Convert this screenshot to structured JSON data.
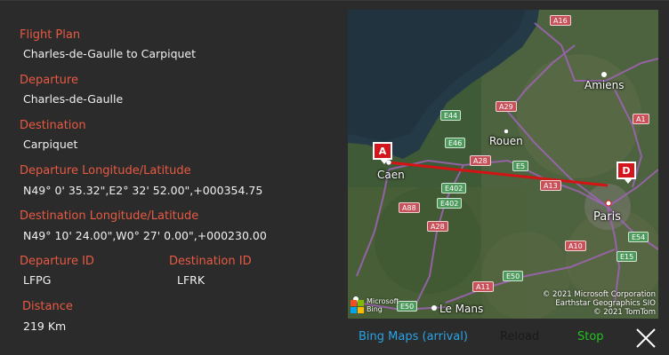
{
  "flight_plan": {
    "label": "Flight Plan",
    "value": "Charles-de-Gaulle to Carpiquet"
  },
  "departure": {
    "label": "Departure",
    "value": "Charles-de-Gaulle"
  },
  "destination": {
    "label": "Destination",
    "value": "Carpiquet"
  },
  "departure_coords": {
    "label": "Departure Longitude/Latitude",
    "value": "N49° 0' 35.32\",E2° 32' 52.00\",+000354.75"
  },
  "destination_coords": {
    "label": "Destination Longitude/Latitude",
    "value": "N49° 10' 24.00\",W0° 27' 0.00\",+000230.00"
  },
  "departure_id": {
    "label": "Departure ID",
    "value": "LFPG"
  },
  "destination_id": {
    "label": "Destination ID",
    "value": "LFRK"
  },
  "distance": {
    "label": "Distance",
    "value": "219 Km"
  },
  "map": {
    "cities": {
      "amiens": "Amiens",
      "rouen": "Rouen",
      "caen": "Caen",
      "paris": "Paris",
      "le_mans": "Le Mans"
    },
    "roads": {
      "a16": "A16",
      "a29": "A29",
      "e44": "E44",
      "e46": "E46",
      "a28_n": "A28",
      "e5_a": "E5",
      "a13": "A13",
      "e402_a": "E402",
      "e402_b": "E402",
      "a88": "A88",
      "a28_s": "A28",
      "a1": "A1",
      "a10": "A10",
      "e54": "E54",
      "e15": "E15",
      "e50_a": "E50",
      "e50_b": "E50",
      "a11": "A11"
    },
    "marker_start": "A",
    "marker_end": "D",
    "copyright": [
      "© 2021 Microsoft Corporation",
      "Earthstar Geographics SIO",
      "© 2021 TomTom"
    ],
    "logo_text": [
      "Microsoft",
      "Bing"
    ],
    "route_color": "#d41414"
  },
  "controls": {
    "bing_maps": "Bing Maps (arrival)",
    "reload": "Reload",
    "stop": "Stop"
  },
  "colors": {
    "label": "#e85a43",
    "link": "#2aa3e6",
    "stop": "#22c322",
    "reload_disabled": "#1a1a1a"
  }
}
